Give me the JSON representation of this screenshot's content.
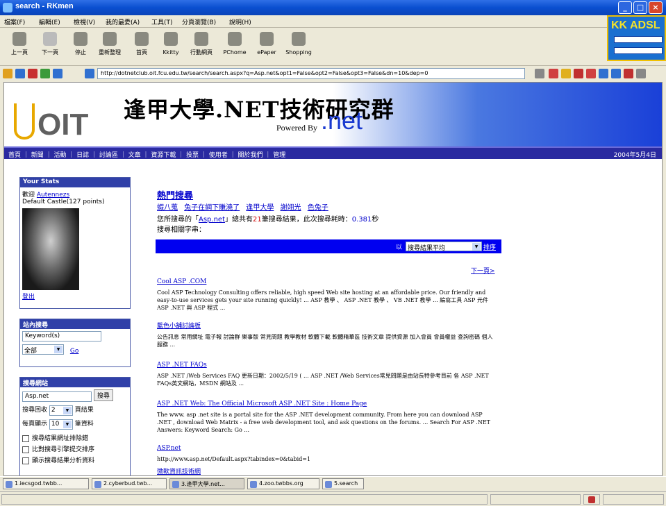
{
  "window": {
    "title": "search - RKmen"
  },
  "menu": [
    "檔案(F)",
    "編輯(E)",
    "檢視(V)",
    "我的最愛(A)",
    "工具(T)",
    "說明(H)",
    "分頁瀏覽(B)",
    "說明(H)"
  ],
  "toolbar": [
    {
      "label": "上一頁",
      "icon": "back-icon"
    },
    {
      "label": "下一頁",
      "icon": "forward-icon"
    },
    {
      "label": "停止",
      "icon": "stop-icon"
    },
    {
      "label": "重新整理",
      "icon": "refresh-icon"
    },
    {
      "label": "首頁",
      "icon": "home-icon"
    },
    {
      "label": "Kkitty",
      "icon": "kitty-icon"
    },
    {
      "label": "行動網頁",
      "icon": "mobile-icon"
    },
    {
      "label": "PChome",
      "icon": "pchome-icon"
    },
    {
      "label": "ePaper",
      "icon": "epaper-icon"
    },
    {
      "label": "Shopping",
      "icon": "shopping-icon"
    }
  ],
  "ad": {
    "title": "KK ADSL"
  },
  "address": {
    "url": "http://dotnetclub.oit.fcu.edu.tw/search/search.aspx?q=Asp.net&opt1=False&opt2=False&opt3=False&dn=10&dep=0"
  },
  "banner": {
    "logo": "OIT",
    "title": "逢甲大學.NET技術研究群",
    "powered": "Powered By",
    "dotnet": ".net"
  },
  "nav": {
    "items": "首頁 ｜ 新聞 ｜ 活動 ｜ 日誌 ｜ 討論區 ｜ 文章 ｜ 資源下載 ｜ 投票 ｜ 使用者 ｜ 關於我們 ｜ 管理",
    "date": "2004年5月4日"
  },
  "stats": {
    "header": "Your Stats",
    "welcome": "歡迎",
    "user": "Autennezs",
    "theme": "Default Castle(127 points)",
    "logout": "登出"
  },
  "sitesearch": {
    "header": "站內搜尋",
    "placeholder": "Keyword(s)",
    "scope": "全部",
    "go": "Go"
  },
  "searchopts": {
    "header": "搜尋網站",
    "query": "Asp.net",
    "button": "搜尋",
    "depth_label": "搜尋回收",
    "depth_value": "2",
    "depth_unit": "頁結果",
    "per_label": "每頁顯示",
    "per_value": "10",
    "per_unit": "筆資料",
    "options": [
      "搜尋結果網址排除錯",
      "比對搜尋引擎提交排序",
      "顯示搜尋結果分析資料"
    ]
  },
  "main": {
    "hot_title": "熱門搜尋",
    "hot_links": [
      "蝦八蒐",
      "兔子在網下賺澆了",
      "逢甲大學",
      "謝翊光",
      "色兔子"
    ],
    "summary_a": "您所搜尋的「",
    "summary_q": "Asp.net",
    "summary_b": "」總共有",
    "summary_n": "21",
    "summary_c": "筆搜尋結果，此次搜尋耗時：",
    "summary_t": "0.381",
    "summary_d": "秒",
    "related": "搜尋相關字串：",
    "sort_label": "以",
    "sort_value": "搜尋結果平均",
    "sort_go": "排序",
    "next": "下一頁>"
  },
  "results": [
    {
      "title": "Cool ASP .COM",
      "desc": "Cool ASP Technology Consulting offers reliable, high speed Web site hosting at an affordable price. Our friendly and easy-to-use services gets your site running quickly! ... ASP 教學 、 ASP .NET 教學 、 VB .NET 教學 ... 編寫工具 ASP 元件 ASP .NET 與 ASP 程式 ..."
    },
    {
      "title": "藍色小舖討論板",
      "desc": "公告訊息 常用網址 電子報 討論群 樂事版 常見問題 教學教材 軟體下載 軟體精華區 技術文章 提供資源 加入會員 會員權益 查詢密碼 個人服務 ..."
    },
    {
      "title": "ASP .NET FAQs",
      "desc": "ASP .NET /Web Services FAQ 更新日期：2002/5/19 ( ... ASP .NET /Web Services常見問題是由站長特參考目前 各 ASP .NET FAQs英文網站，MSDN 網站及 ..."
    },
    {
      "title": "ASP .NET Web: The Official Microsoft ASP .NET Site : Home Page",
      "desc": "The www. asp .net site is a portal site for the ASP .NET development community. From here you can download ASP .NET , download Web Matrix - a free web development tool, and ask questions on the forums. ... Search For ASP .NET Answers: Keyword Search: Go ..."
    },
    {
      "title": "ASP.net",
      "desc": "http://www.asp.net/Default.aspx?tabindex=0&tabid=1"
    },
    {
      "title": "微軟資訊技術網",
      "desc": ""
    }
  ],
  "taskbar": [
    "1.iecsgod.twbb...",
    "2.cyberbud.twb...",
    "3.逢甲大學.net...",
    "4.zoo.twbbs.org",
    "5.search"
  ]
}
